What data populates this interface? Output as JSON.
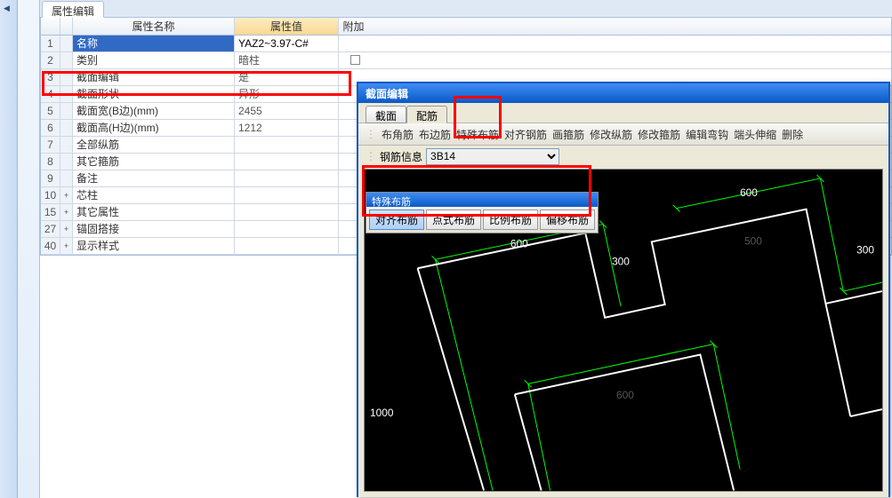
{
  "tab": {
    "label": "属性编辑"
  },
  "header": {
    "name": "属性名称",
    "value": "属性值",
    "extra": "附加"
  },
  "rows": [
    {
      "n": "1",
      "exp": "",
      "name": "名称",
      "val": "YAZ2~3.97-C#",
      "cls": "selected"
    },
    {
      "n": "2",
      "exp": "",
      "name": "类别",
      "val": "暗柱",
      "cls": "link"
    },
    {
      "n": "3",
      "exp": "",
      "name": "截面编辑",
      "val": "是",
      "cls": "link"
    },
    {
      "n": "4",
      "exp": "",
      "name": "截面形状",
      "val": "异形",
      "cls": "link"
    },
    {
      "n": "5",
      "exp": "",
      "name": "截面宽(B边)(mm)",
      "val": "2455",
      "cls": "gray"
    },
    {
      "n": "6",
      "exp": "",
      "name": "截面高(H边)(mm)",
      "val": "1212",
      "cls": "gray"
    },
    {
      "n": "7",
      "exp": "",
      "name": "全部纵筋",
      "val": "",
      "cls": "link"
    },
    {
      "n": "8",
      "exp": "",
      "name": "其它箍筋",
      "val": "",
      "cls": "link"
    },
    {
      "n": "9",
      "exp": "",
      "name": "备注",
      "val": "",
      "cls": "link"
    },
    {
      "n": "10",
      "exp": "+",
      "name": "芯柱",
      "val": "",
      "cls": "gray"
    },
    {
      "n": "15",
      "exp": "+",
      "name": "其它属性",
      "val": "",
      "cls": "gray"
    },
    {
      "n": "27",
      "exp": "+",
      "name": "锚固搭接",
      "val": "",
      "cls": "gray"
    },
    {
      "n": "40",
      "exp": "+",
      "name": "显示样式",
      "val": "",
      "cls": "gray"
    }
  ],
  "dialog": {
    "title": "截面编辑",
    "tabs": [
      "截面",
      "配筋"
    ],
    "activeTab": 1,
    "toolbar": [
      "布角筋",
      "布边筋",
      "特殊布筋",
      "对齐钢筋",
      "画箍筋",
      "修改纵筋",
      "修改箍筋",
      "编辑弯钩",
      "端头伸缩",
      "删除"
    ],
    "infoLabel": "钢筋信息",
    "infoValue": "3B14",
    "popup": {
      "title": "特殊布筋",
      "buttons": [
        "对齐布筋",
        "点式布筋",
        "比例布筋",
        "偏移布筋"
      ],
      "active": 0
    },
    "dims": {
      "d600a": "600",
      "d300a": "300",
      "d600b": "600",
      "d500": "500",
      "d300b": "300",
      "d1000": "1000",
      "d600c": "600"
    }
  }
}
